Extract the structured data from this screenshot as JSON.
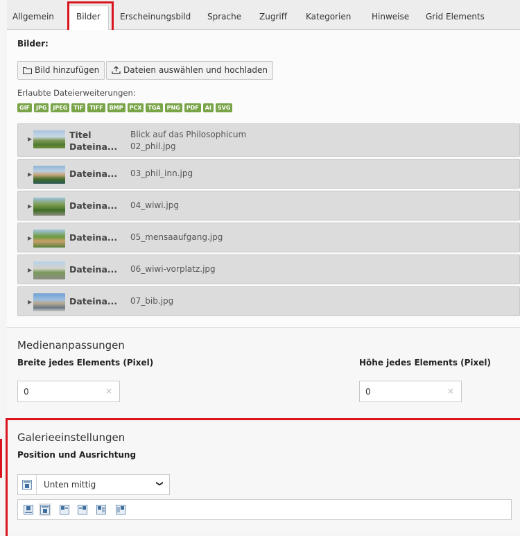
{
  "tabs": [
    {
      "label": "Allgemein"
    },
    {
      "label": "Bilder"
    },
    {
      "label": "Erscheinungsbild"
    },
    {
      "label": "Sprache"
    },
    {
      "label": "Zugriff"
    },
    {
      "label": "Kategorien"
    },
    {
      "label": "Hinweise"
    },
    {
      "label": "Grid Elements"
    }
  ],
  "images": {
    "section_label": "Bilder:",
    "add_button": "Bild hinzufügen",
    "upload_button": "Dateien auswählen und hochladen",
    "allowed_label": "Erlaubte Dateierweiterungen:",
    "extensions": [
      "GIF",
      "JPG",
      "JPEG",
      "TIF",
      "TIFF",
      "BMP",
      "PCX",
      "TGA",
      "PNG",
      "PDF",
      "AI",
      "SVG"
    ],
    "files": [
      {
        "title_key": "Titel",
        "title": "Blick auf das Philosophicum",
        "name_key": "Dateina...",
        "name": "02_phil.jpg"
      },
      {
        "name_key": "Dateina...",
        "name": "03_phil_inn.jpg"
      },
      {
        "name_key": "Dateina...",
        "name": "04_wiwi.jpg"
      },
      {
        "name_key": "Dateina...",
        "name": "05_mensaaufgang.jpg"
      },
      {
        "name_key": "Dateina...",
        "name": "06_wiwi-vorplatz.jpg"
      },
      {
        "name_key": "Dateina...",
        "name": "07_bib.jpg"
      }
    ]
  },
  "media": {
    "title": "Medienanpassungen",
    "width_label": "Breite jedes Elements (Pixel)",
    "width_value": "0",
    "height_label": "Höhe jedes Elements (Pixel)",
    "height_value": "0",
    "clear_symbol": "×"
  },
  "gallery": {
    "title": "Galerieeinstellungen",
    "position_label": "Position und Ausrichtung",
    "position_selected": "Unten mittig",
    "chevron": "❯"
  },
  "colors": {
    "highlight": "#d9141c",
    "badge": "#79a548",
    "file_row": "#dcdcdc"
  }
}
